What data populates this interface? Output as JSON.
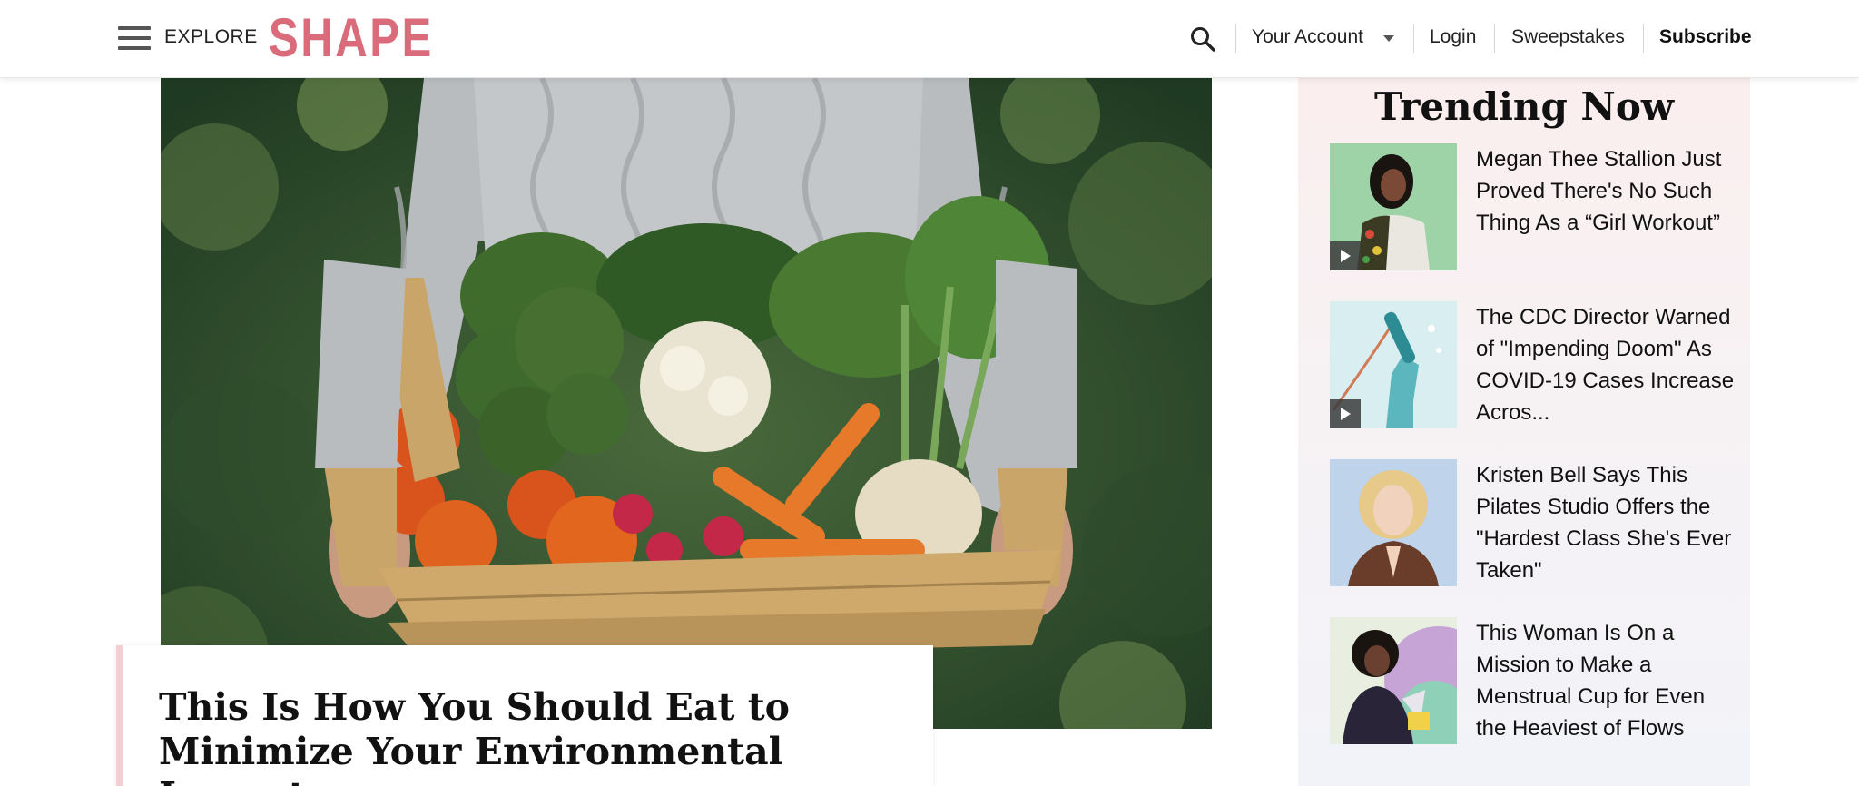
{
  "header": {
    "explore_label": "EXPLORE",
    "logo_text": "SHAPE",
    "logo_color": "#d96b7a",
    "account_label": "Your Account",
    "login_label": "Login",
    "sweepstakes_label": "Sweepstakes",
    "subscribe_label": "Subscribe"
  },
  "hero": {
    "headline": "This Is How You Should Eat to Minimize Your Environmental Impact"
  },
  "trending": {
    "title": "Trending Now",
    "items": [
      {
        "title": "Megan Thee Stallion Just Proved There's No Such Thing As a “Girl Workout”",
        "has_video": true
      },
      {
        "title": "The CDC Director Warned of \"Impending Doom\" As COVID-19 Cases Increase Acros...",
        "has_video": true
      },
      {
        "title": "Kristen Bell Says This Pilates Studio Offers the \"Hardest Class She's Ever Taken\"",
        "has_video": false
      },
      {
        "title": "This Woman Is On a Mission to Make a Menstrual Cup for Even the Heaviest of Flows",
        "has_video": false
      }
    ]
  }
}
